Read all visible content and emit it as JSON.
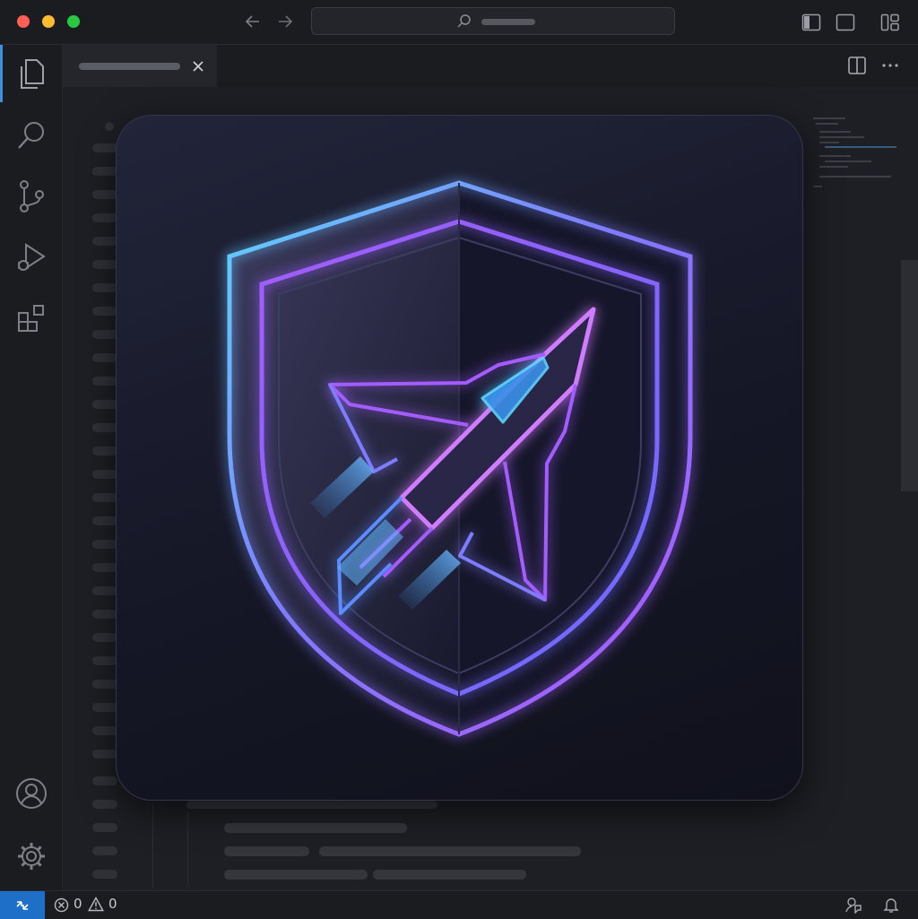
{
  "window": {
    "traffic_lights": {
      "close": "#ff5f57",
      "minimize": "#febc2e",
      "maximize": "#28c840"
    }
  },
  "titlebar": {
    "icons": [
      "arrow-left-icon",
      "arrow-right-icon",
      "search-icon",
      "toggle-primary-sidebar-icon",
      "toggle-panel-icon",
      "customize-layout-icon"
    ]
  },
  "activity_bar": {
    "items": [
      "explorer-icon",
      "search-icon",
      "source-control-icon",
      "run-debug-icon",
      "extensions-icon"
    ],
    "bottom_items": [
      "account-icon",
      "settings-gear-icon"
    ],
    "active_accent": "#3d8fe0"
  },
  "editor": {
    "tab_actions": [
      "split-editor-icon",
      "more-actions-icon"
    ],
    "logo": {
      "icon": "shield-rocket-logo",
      "colors": {
        "cyan": "#5fd4ff",
        "blue": "#5b8cff",
        "purple": "#a45cff",
        "magenta": "#d07cff"
      }
    }
  },
  "status_bar": {
    "errors": "0",
    "warnings": "0",
    "remote_color": "#1e6fc7"
  }
}
